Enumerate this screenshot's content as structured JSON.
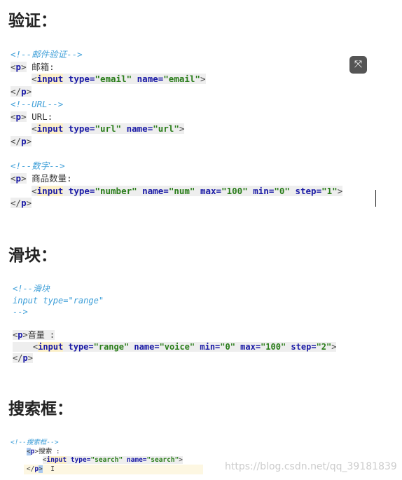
{
  "headings": {
    "validation": "验证：",
    "slider": "滑块：",
    "search": "搜索框："
  },
  "watermark": "https://blog.csdn.net/qq_39181839",
  "expand_icon": "expand-icon",
  "blocks": [
    [
      [
        {
          "t": "<!--邮件验证-->",
          "c": "cm"
        }
      ],
      [
        {
          "t": "<",
          "c": "pu hl"
        },
        {
          "t": "p",
          "c": "tg hl"
        },
        {
          "t": ">",
          "c": "pu hl"
        },
        {
          "t": " 邮箱:",
          "c": "tx"
        }
      ],
      [
        {
          "t": "    ",
          "c": ""
        },
        {
          "t": "<",
          "c": "pu hl"
        },
        {
          "t": "input",
          "c": "kw"
        },
        {
          "t": " type=",
          "c": "at hl"
        },
        {
          "t": "\"email\"",
          "c": "st hl"
        },
        {
          "t": " name=",
          "c": "at hl"
        },
        {
          "t": "\"email\"",
          "c": "st hl"
        },
        {
          "t": ">",
          "c": "pu hl"
        }
      ],
      [
        {
          "t": "</",
          "c": "pu hl"
        },
        {
          "t": "p",
          "c": "tg hl"
        },
        {
          "t": ">",
          "c": "pu hl"
        }
      ],
      [
        {
          "t": "<!--URL-->",
          "c": "cm"
        }
      ],
      [
        {
          "t": "<",
          "c": "pu hl"
        },
        {
          "t": "p",
          "c": "tg hl"
        },
        {
          "t": ">",
          "c": "pu hl"
        },
        {
          "t": " URL:",
          "c": "tx"
        }
      ],
      [
        {
          "t": "    ",
          "c": ""
        },
        {
          "t": "<",
          "c": "pu hl"
        },
        {
          "t": "input",
          "c": "kw"
        },
        {
          "t": " type=",
          "c": "at hl"
        },
        {
          "t": "\"url\"",
          "c": "st hl"
        },
        {
          "t": " name=",
          "c": "at hl"
        },
        {
          "t": "\"url\"",
          "c": "st hl"
        },
        {
          "t": ">",
          "c": "pu hl"
        }
      ],
      [
        {
          "t": "</",
          "c": "pu hl"
        },
        {
          "t": "p",
          "c": "tg hl"
        },
        {
          "t": ">",
          "c": "pu hl"
        }
      ],
      [
        {
          "t": " ",
          "c": ""
        }
      ],
      [
        {
          "t": "<!--数字-->",
          "c": "cm"
        }
      ],
      [
        {
          "t": "<",
          "c": "pu hl"
        },
        {
          "t": "p",
          "c": "tg hl"
        },
        {
          "t": ">",
          "c": "pu hl"
        },
        {
          "t": " 商品数量:",
          "c": "tx"
        }
      ],
      [
        {
          "t": "    ",
          "c": ""
        },
        {
          "t": "<",
          "c": "pu hl"
        },
        {
          "t": "input",
          "c": "kw"
        },
        {
          "t": " type=",
          "c": "at hl"
        },
        {
          "t": "\"number\"",
          "c": "st hl"
        },
        {
          "t": " name=",
          "c": "at hl"
        },
        {
          "t": "\"num\"",
          "c": "st hl"
        },
        {
          "t": " max=",
          "c": "at hl"
        },
        {
          "t": "\"100\"",
          "c": "st hl"
        },
        {
          "t": " min=",
          "c": "at hl"
        },
        {
          "t": "\"0\"",
          "c": "st hl"
        },
        {
          "t": " step=",
          "c": "at hl"
        },
        {
          "t": "\"1\"",
          "c": "st hl"
        },
        {
          "t": ">",
          "c": "pu hl"
        }
      ],
      [
        {
          "t": "</",
          "c": "pu hl"
        },
        {
          "t": "p",
          "c": "tg hl"
        },
        {
          "t": ">",
          "c": "pu hl"
        }
      ]
    ],
    [
      [
        {
          "t": "<!--滑块",
          "c": "cm"
        }
      ],
      [
        {
          "t": "input type=\"range\"",
          "c": "cm"
        }
      ],
      [
        {
          "t": "-->",
          "c": "cm"
        }
      ],
      [
        {
          "t": " ",
          "c": ""
        }
      ],
      [
        {
          "t": "<",
          "c": "pu hl"
        },
        {
          "t": "p",
          "c": "tg hl"
        },
        {
          "t": ">",
          "c": "pu hl"
        },
        {
          "t": "音量 :",
          "c": "tx hl"
        }
      ],
      [
        {
          "t": "    ",
          "c": "hl"
        },
        {
          "t": "<",
          "c": "pu hl"
        },
        {
          "t": "input",
          "c": "kw"
        },
        {
          "t": " type=",
          "c": "at hl"
        },
        {
          "t": "\"range\"",
          "c": "st hl"
        },
        {
          "t": " name=",
          "c": "at hl"
        },
        {
          "t": "\"voice\"",
          "c": "st hl"
        },
        {
          "t": " min=",
          "c": "at hl"
        },
        {
          "t": "\"0\"",
          "c": "st hl"
        },
        {
          "t": " max=",
          "c": "at hl"
        },
        {
          "t": "\"100\"",
          "c": "st hl"
        },
        {
          "t": " step=",
          "c": "at hl"
        },
        {
          "t": "\"2\"",
          "c": "st hl"
        },
        {
          "t": ">",
          "c": "pu hl"
        }
      ],
      [
        {
          "t": "</",
          "c": "pu hl"
        },
        {
          "t": "p",
          "c": "tg hl"
        },
        {
          "t": ">",
          "c": "pu hl"
        }
      ]
    ],
    [
      [
        {
          "t": "<!--搜索框-->",
          "c": "cm"
        }
      ],
      [
        {
          "t": "    ",
          "c": ""
        },
        {
          "t": "<",
          "c": "pu sel"
        },
        {
          "t": "p",
          "c": "tg"
        },
        {
          "t": ">",
          "c": "pu"
        },
        {
          "t": "搜索 :",
          "c": "tx"
        }
      ],
      [
        {
          "t": "        ",
          "c": ""
        },
        {
          "t": "<",
          "c": "pu hl"
        },
        {
          "t": "input",
          "c": "kw"
        },
        {
          "t": " type=",
          "c": "at hl"
        },
        {
          "t": "\"search\"",
          "c": "st hl"
        },
        {
          "t": " name=",
          "c": "at hl"
        },
        {
          "t": "\"search\"",
          "c": "st hl"
        },
        {
          "t": ">",
          "c": "pu hl"
        }
      ],
      [
        {
          "t": "    ",
          "c": ""
        },
        {
          "t": "</",
          "c": "pu"
        },
        {
          "t": "p",
          "c": "tg"
        },
        {
          "t": ">",
          "c": "pu sel"
        },
        {
          "t": "  I",
          "c": "pu"
        }
      ]
    ]
  ]
}
